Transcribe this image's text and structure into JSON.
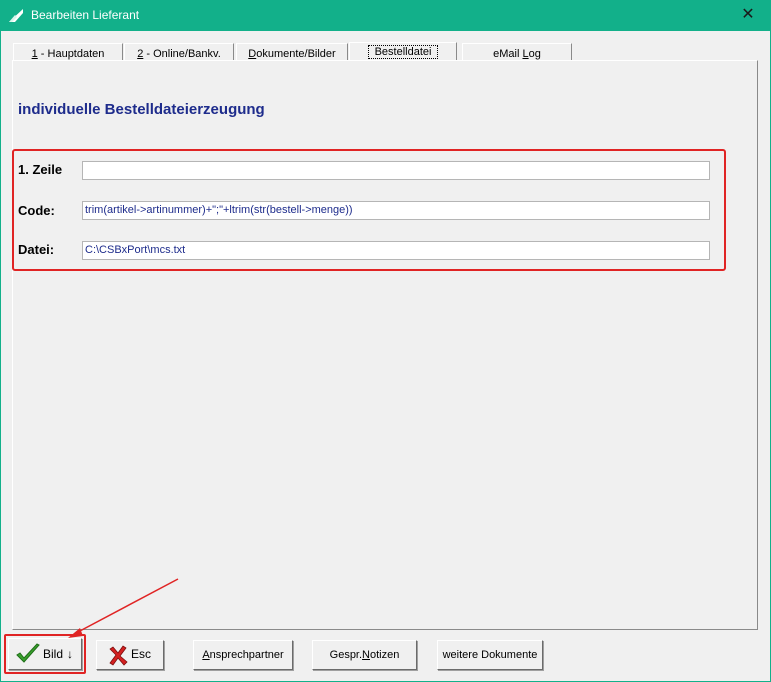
{
  "window": {
    "title": "Bearbeiten Lieferant",
    "close_label": "✕"
  },
  "tabs": [
    {
      "key": "1",
      "label": " - Hauptdaten"
    },
    {
      "key": "2",
      "label": " - Online/Bankv."
    },
    {
      "key": "D",
      "label": "okumente/Bilder"
    },
    {
      "key": "",
      "label": "Bestelldatei"
    },
    {
      "key": "L",
      "label_pre": "eMail ",
      "label": "og"
    }
  ],
  "panel": {
    "heading": "individuelle Bestelldateierzeugung",
    "fields": {
      "zeile_label": "1. Zeile",
      "zeile_value": "",
      "code_label": "Code:",
      "code_value": "trim(artikel->artinummer)+\";\"+ltrim(str(bestell->menge))",
      "datei_label": "Datei:",
      "datei_value": "C:\\CSBxPort\\mcs.txt"
    }
  },
  "buttons": {
    "bild": "Bild",
    "bild_arrow": "↓",
    "esc": "Esc",
    "ansprech_key": "A",
    "ansprech_rest": "nsprechpartner",
    "gespr_pre": "Gespr.",
    "gespr_key": "N",
    "gespr_rest": "otizen",
    "weitere": "weitere Dokumente"
  },
  "colors": {
    "titlebar": "#12b08a",
    "heading": "#1e2c8c",
    "highlight": "#e02424"
  },
  "icons": {
    "app": "app-logo-icon",
    "bild": "checkmark-icon",
    "esc": "red-x-icon"
  }
}
